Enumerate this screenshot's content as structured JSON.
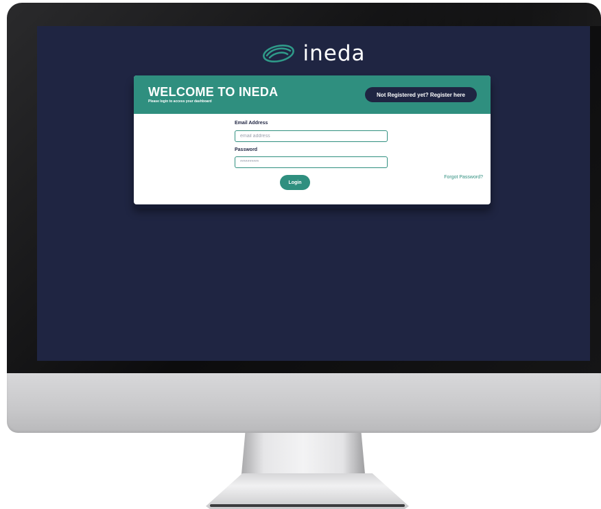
{
  "brand": {
    "logo_text": "ineda",
    "accent_color": "#2f8f7f",
    "navy_color": "#1f2542"
  },
  "login_card": {
    "title": "WELCOME TO INEDA",
    "subtitle": "Please login to access your dashboard",
    "register_button_label": "Not Registered yet? Register here",
    "email": {
      "label": "Email Address",
      "placeholder": "email address",
      "value": ""
    },
    "password": {
      "label": "Password",
      "value": "**********"
    },
    "login_button_label": "Login",
    "forgot_password_label": "Forgot Password?"
  },
  "icons": {
    "logo": "eye-swoosh-icon"
  }
}
